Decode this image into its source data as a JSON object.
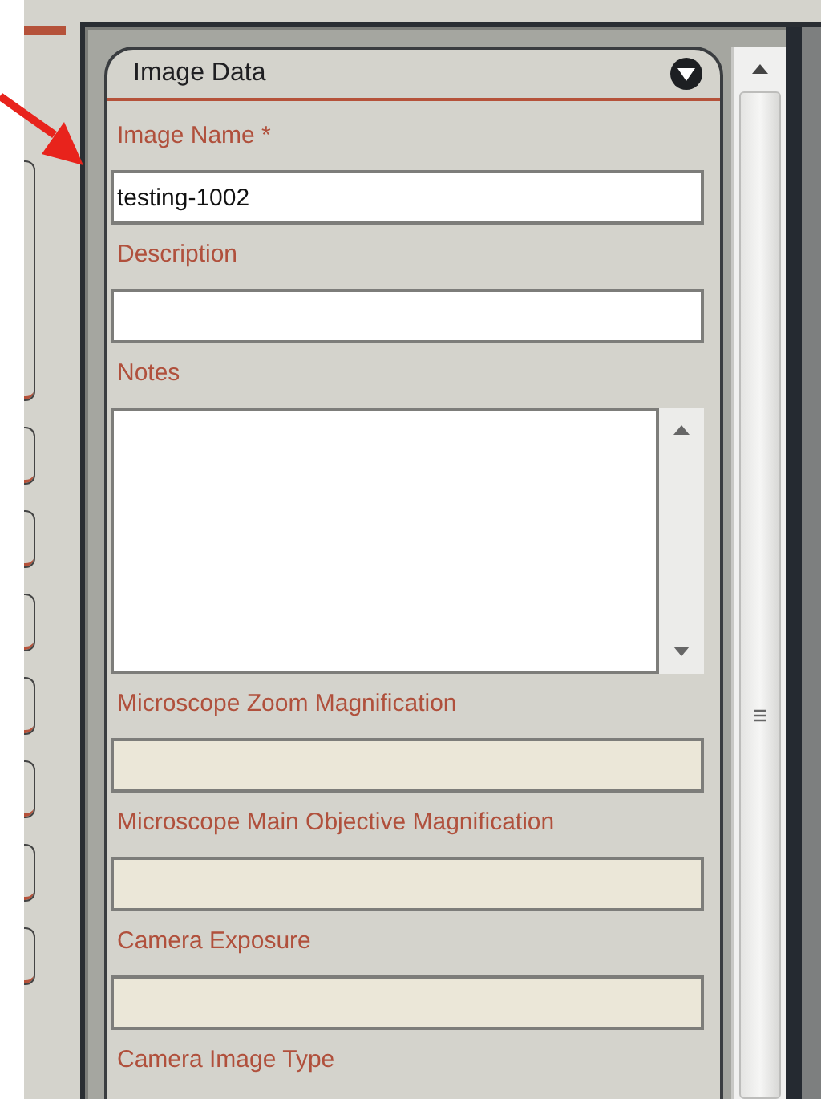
{
  "panel": {
    "title": "Image Data",
    "expanded": true
  },
  "fields": [
    {
      "label": "Image Name *",
      "kind": "text",
      "value": "testing-1002",
      "disabled": false
    },
    {
      "label": "Description",
      "kind": "text",
      "disabled": false
    },
    {
      "label": "Notes",
      "kind": "textarea",
      "disabled": false
    },
    {
      "label": "Microscope Zoom Magnification",
      "kind": "text",
      "disabled": true
    },
    {
      "label": "Microscope Main Objective Magnification",
      "kind": "text",
      "disabled": true
    },
    {
      "label": "Camera Exposure",
      "kind": "text",
      "disabled": true
    },
    {
      "label": "Camera Image Type",
      "kind": "label"
    }
  ]
}
